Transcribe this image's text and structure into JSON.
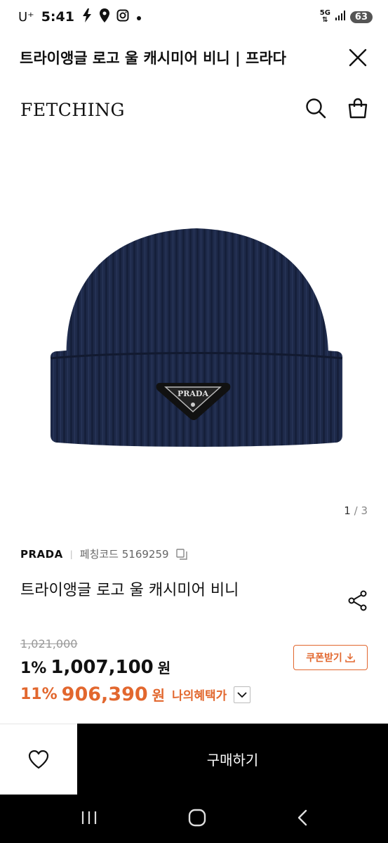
{
  "status_bar": {
    "carrier": "U⁺",
    "time": "5:41",
    "network": "5G",
    "battery": "63",
    "icons": [
      "bolt-icon",
      "location-icon",
      "instagram-icon",
      "dot-icon",
      "wifi-icon",
      "signal-icon"
    ]
  },
  "webview": {
    "title": "트라이앵글 로고 울 캐시미어 비니 | 프라다",
    "close_icon": "close-icon"
  },
  "header": {
    "logo": "FETCHING",
    "icons": [
      "search-icon",
      "shopping-bag-icon"
    ]
  },
  "gallery": {
    "current": "1",
    "separator": "/",
    "total": "3",
    "image_subject": "navy ribbed knit beanie with triangle logo plaque",
    "plaque_text": "PRADA"
  },
  "product": {
    "brand": "PRADA",
    "separator": "|",
    "code_label": "페칭코드 5169259",
    "name": "트라이앵글 로고 울 캐시미어 비니"
  },
  "pricing": {
    "original_price": "1,021,000",
    "discount_rate": "1%",
    "price": "1,007,100",
    "currency": "원",
    "benefit_rate": "11%",
    "benefit_price": "906,390",
    "benefit_label": "나의혜택가",
    "coupon_label": "쿠폰받기"
  },
  "bottom_bar": {
    "buy_label": "구매하기"
  },
  "colors": {
    "accent": "#e2672e",
    "buy_bg": "#000000",
    "beanie": "#1e2a4a"
  }
}
